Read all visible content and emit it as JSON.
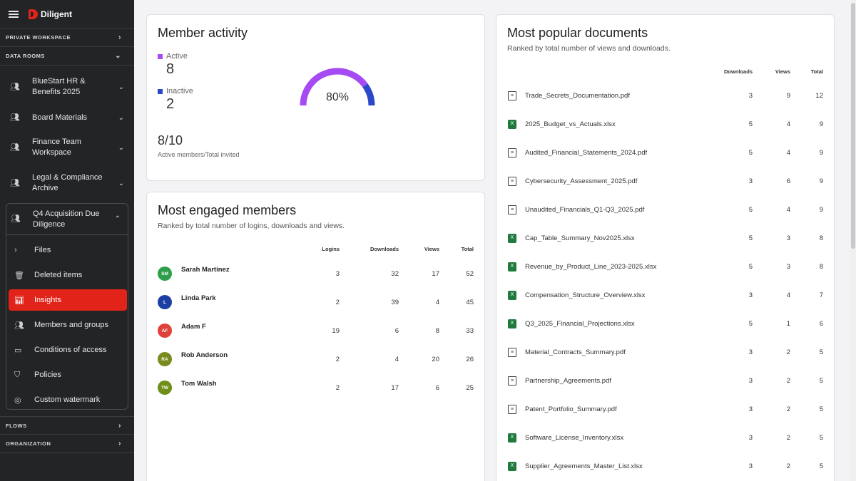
{
  "app": {
    "brand": "Diligent"
  },
  "sidebar": {
    "sections": {
      "private_workspace": "PRIVATE WORKSPACE",
      "data_rooms": "DATA ROOMS",
      "flows": "FLOWS",
      "organization": "ORGANIZATION"
    },
    "rooms": [
      {
        "label": "BlueStart HR & Benefits 2025"
      },
      {
        "label": "Board Materials"
      },
      {
        "label": "Finance Team Workspace"
      },
      {
        "label": "Legal & Compliance Archive"
      }
    ],
    "active_room": {
      "label": "Q4 Acquisition Due Diligence"
    },
    "subitems": [
      {
        "label": "Files",
        "icon": "chevron-right-icon"
      },
      {
        "label": "Deleted items",
        "icon": "trash-icon"
      },
      {
        "label": "Insights",
        "icon": "bar-chart-icon"
      },
      {
        "label": "Members and groups",
        "icon": "users-icon"
      },
      {
        "label": "Conditions of access",
        "icon": "document-icon"
      },
      {
        "label": "Policies",
        "icon": "shield-icon"
      },
      {
        "label": "Custom watermark",
        "icon": "watermark-icon"
      }
    ]
  },
  "member_activity": {
    "title": "Member activity",
    "active_label": "Active",
    "active_value": "8",
    "inactive_label": "Inactive",
    "inactive_value": "2",
    "ratio": "8/10",
    "ratio_caption": "Active members/Total invited",
    "percent": "80%",
    "active_fraction": 0.8,
    "colors": {
      "active": "#a64bf4",
      "inactive": "#2b48c9"
    }
  },
  "engaged_members": {
    "title": "Most engaged members",
    "subtitle": "Ranked by total number of logins, downloads and views.",
    "headers": {
      "logins": "Logins",
      "downloads": "Downloads",
      "views": "Views",
      "total": "Total"
    },
    "rows": [
      {
        "initials": "SM",
        "name": "Sarah Martinez",
        "color": "#2e9e4a",
        "logins": "3",
        "downloads": "32",
        "views": "17",
        "total": "52"
      },
      {
        "initials": "L",
        "name": "Linda Park",
        "color": "#1d3fa3",
        "logins": "2",
        "downloads": "39",
        "views": "4",
        "total": "45"
      },
      {
        "initials": "AF",
        "name": "Adam F",
        "color": "#e0413a",
        "logins": "19",
        "downloads": "6",
        "views": "8",
        "total": "33"
      },
      {
        "initials": "RA",
        "name": "Rob Anderson",
        "color": "#7a8a1e",
        "logins": "2",
        "downloads": "4",
        "views": "20",
        "total": "26"
      },
      {
        "initials": "TW",
        "name": "Tom Walsh",
        "color": "#6f8f1a",
        "logins": "2",
        "downloads": "17",
        "views": "6",
        "total": "25"
      }
    ]
  },
  "popular_documents": {
    "title": "Most popular documents",
    "subtitle": "Ranked by total number of views and downloads.",
    "headers": {
      "downloads": "Downloads",
      "views": "Views",
      "total": "Total"
    },
    "rows": [
      {
        "name": "Trade_Secrets_Documentation.pdf",
        "type": "pdf",
        "downloads": "3",
        "views": "9",
        "total": "12"
      },
      {
        "name": "2025_Budget_vs_Actuals.xlsx",
        "type": "xlsx",
        "downloads": "5",
        "views": "4",
        "total": "9"
      },
      {
        "name": "Audited_Financial_Statements_2024.pdf",
        "type": "pdf",
        "downloads": "5",
        "views": "4",
        "total": "9"
      },
      {
        "name": "Cybersecurity_Assessment_2025.pdf",
        "type": "pdf",
        "downloads": "3",
        "views": "6",
        "total": "9"
      },
      {
        "name": "Unaudited_Financials_Q1-Q3_2025.pdf",
        "type": "pdf",
        "downloads": "5",
        "views": "4",
        "total": "9"
      },
      {
        "name": "Cap_Table_Summary_Nov2025.xlsx",
        "type": "xlsx",
        "downloads": "5",
        "views": "3",
        "total": "8"
      },
      {
        "name": "Revenue_by_Product_Line_2023-2025.xlsx",
        "type": "xlsx",
        "downloads": "5",
        "views": "3",
        "total": "8"
      },
      {
        "name": "Compensation_Structure_Overview.xlsx",
        "type": "xlsx",
        "downloads": "3",
        "views": "4",
        "total": "7"
      },
      {
        "name": "Q3_2025_Financial_Projections.xlsx",
        "type": "xlsx",
        "downloads": "5",
        "views": "1",
        "total": "6"
      },
      {
        "name": "Material_Contracts_Summary.pdf",
        "type": "pdf",
        "downloads": "3",
        "views": "2",
        "total": "5"
      },
      {
        "name": "Partnership_Agreements.pdf",
        "type": "pdf",
        "downloads": "3",
        "views": "2",
        "total": "5"
      },
      {
        "name": "Patent_Portfolio_Summary.pdf",
        "type": "pdf",
        "downloads": "3",
        "views": "2",
        "total": "5"
      },
      {
        "name": "Software_License_Inventory.xlsx",
        "type": "xlsx",
        "downloads": "3",
        "views": "2",
        "total": "5"
      },
      {
        "name": "Supplier_Agreements_Master_List.xlsx",
        "type": "xlsx",
        "downloads": "3",
        "views": "2",
        "total": "5"
      }
    ]
  }
}
